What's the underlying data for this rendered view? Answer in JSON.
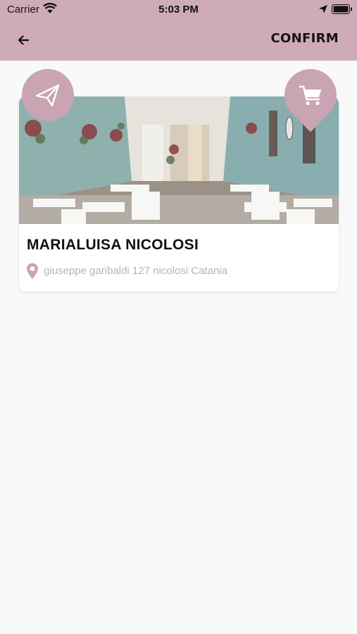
{
  "status_bar": {
    "carrier": "Carrier",
    "time": "5:03 PM"
  },
  "header": {
    "back_icon": "arrow-left-icon",
    "confirm_label": "CONFIRM",
    "background_color": "#cfabb7"
  },
  "actions": {
    "send_icon": "paper-plane-icon",
    "cart_icon": "shopping-cart-icon",
    "accent_color": "#c9a4b3"
  },
  "shop": {
    "name": "MARIALUISA NICOLOSI",
    "address": "giuseppe garibaldi 127 nicolosi Catania",
    "address_icon": "map-pin-icon"
  }
}
